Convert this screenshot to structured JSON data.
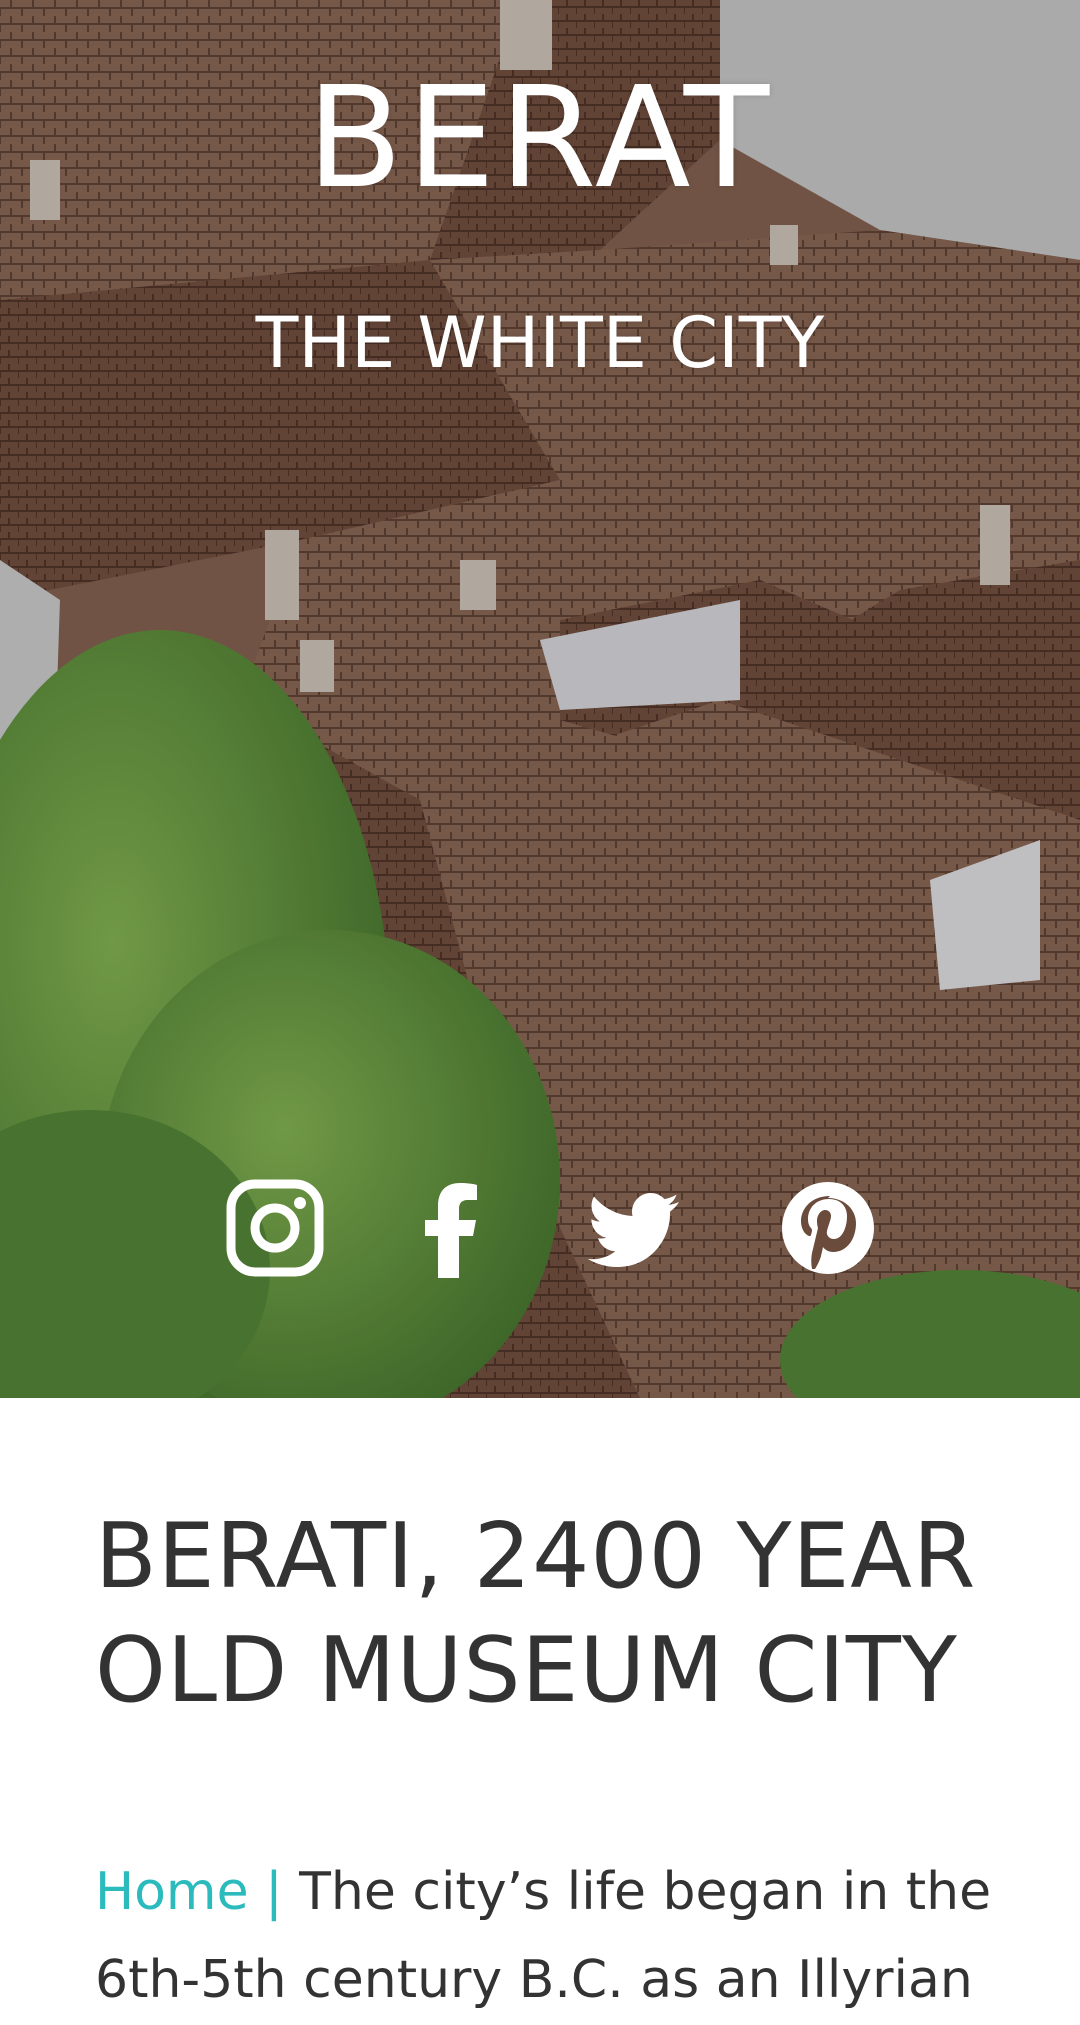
{
  "hero": {
    "title": "BERAT",
    "subtitle": "THE WHITE CITY"
  },
  "social": {
    "icons": [
      "instagram-icon",
      "facebook-icon",
      "twitter-icon",
      "pinterest-icon"
    ]
  },
  "article": {
    "title": "BERATI, 2400 YEAR OLD MUSEUM CITY",
    "breadcrumb": "Home |",
    "intro": "The city’s life began in the 6th-5th century B.C. as an Illyrian"
  },
  "colors": {
    "accent": "#2bbbbd",
    "text": "#333333",
    "hero_text": "#ffffff"
  }
}
